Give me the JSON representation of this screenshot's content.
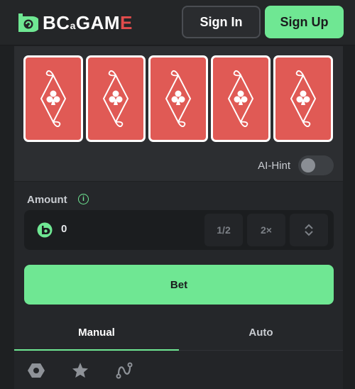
{
  "header": {
    "logo_text_main": "BC",
    "logo_text_small": "a",
    "logo_text_game": "GAM",
    "logo_text_e": "E",
    "signin_label": "Sign In",
    "signup_label": "Sign Up"
  },
  "game": {
    "cards": [
      "club-card",
      "club-card",
      "club-card",
      "club-card",
      "club-card"
    ],
    "ai_hint_label": "AI-Hint",
    "ai_hint_on": false
  },
  "bet": {
    "amount_label": "Amount",
    "amount_value": "0",
    "half_label": "1/2",
    "double_label": "2×",
    "bet_label": "Bet"
  },
  "tabs": {
    "manual": "Manual",
    "auto": "Auto"
  },
  "colors": {
    "accent": "#6fe793",
    "card_red": "#e05a55"
  }
}
